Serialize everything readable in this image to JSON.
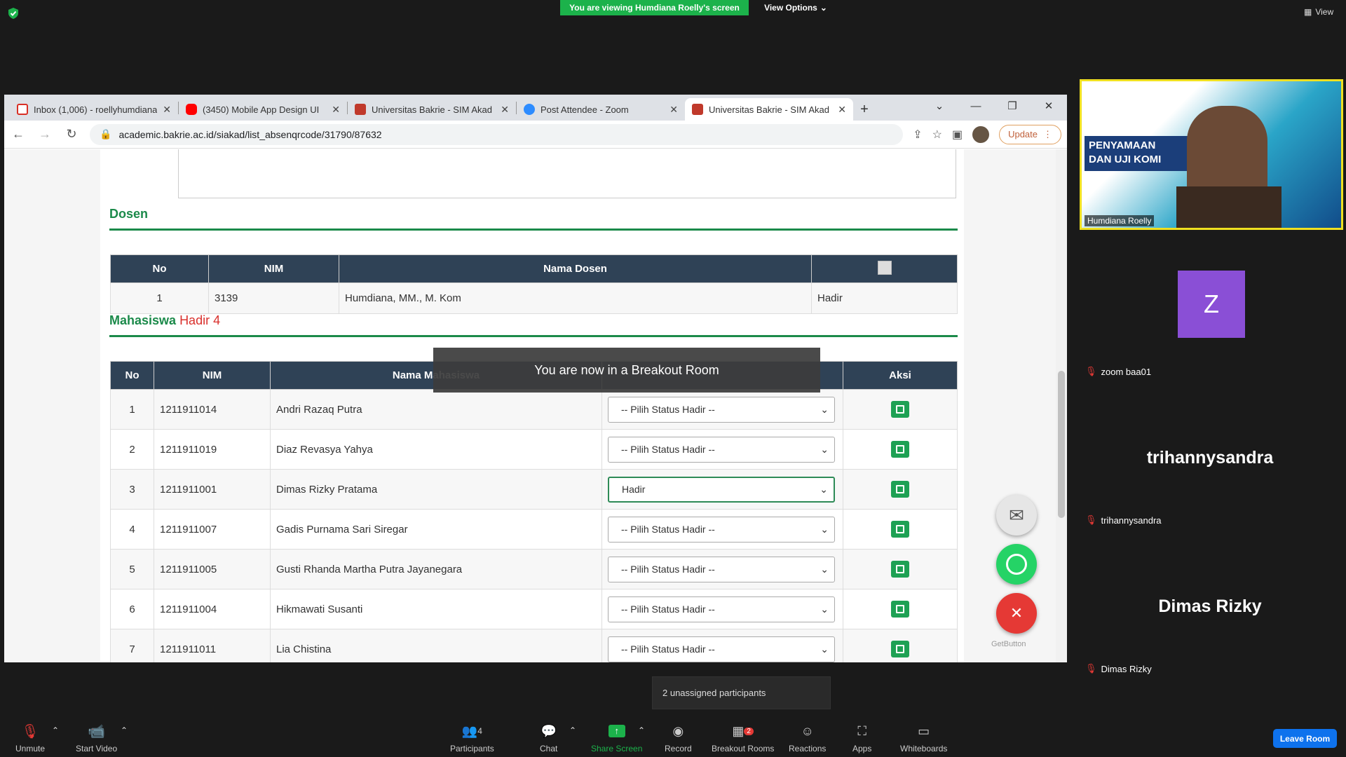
{
  "zoom": {
    "viewing_banner": "You are viewing Humdiana Roelly's screen",
    "view_options": "View Options",
    "view_top": "View",
    "breakout_toast": "You are now in a Breakout Room",
    "unassigned": "2 unassigned participants",
    "toolbar": {
      "unmute": "Unmute",
      "start_video": "Start Video",
      "participants": "Participants",
      "participants_count": "4",
      "chat": "Chat",
      "share_screen": "Share Screen",
      "record": "Record",
      "breakout_rooms": "Breakout Rooms",
      "breakout_badge": "2",
      "reactions": "Reactions",
      "apps": "Apps",
      "whiteboards": "Whiteboards",
      "leave_room": "Leave Room"
    },
    "participants": [
      {
        "name": "Humdiana Roelly",
        "slide_title_1": "PENYAMAAN",
        "slide_title_2": "DAN UJI KOMI"
      },
      {
        "name": "zoom baa01",
        "initial": "Z"
      },
      {
        "name": "trihannysandra",
        "big": "trihannysandra"
      },
      {
        "name": "Dimas Rizky",
        "big": "Dimas Rizky"
      }
    ],
    "getbutton": "GetButton"
  },
  "browser": {
    "tabs": [
      {
        "title": "Inbox (1,006) - roellyhumdiana",
        "icon": "gmail-icon"
      },
      {
        "title": "(3450) Mobile App Design UI",
        "icon": "youtube-icon"
      },
      {
        "title": "Universitas Bakrie - SIM Akad",
        "icon": "bakrie-icon"
      },
      {
        "title": "Post Attendee - Zoom",
        "icon": "zoom-icon"
      },
      {
        "title": "Universitas Bakrie - SIM Akad",
        "icon": "bakrie-icon"
      }
    ],
    "url": "academic.bakrie.ac.id/siakad/list_absenqrcode/31790/87632",
    "update": "Update"
  },
  "page": {
    "dosen_title": "Dosen",
    "dosen_headers": [
      "No",
      "NIM",
      "Nama Dosen",
      ""
    ],
    "dosen_rows": [
      {
        "no": "1",
        "nim": "3139",
        "nama": "Humdiana, MM., M. Kom",
        "status": "Hadir"
      }
    ],
    "mhs_title": "Mahasiswa",
    "mhs_hadir_label": "Hadir",
    "mhs_hadir_count": "4",
    "mhs_headers": [
      "No",
      "NIM",
      "Nama Mahasiswa",
      "",
      "Aksi"
    ],
    "mhs_rows": [
      {
        "no": "1",
        "nim": "1211911014",
        "nama": "Andri Razaq Putra",
        "status": "-- Pilih Status Hadir --"
      },
      {
        "no": "2",
        "nim": "1211911019",
        "nama": "Diaz Revasya Yahya",
        "status": "-- Pilih Status Hadir --"
      },
      {
        "no": "3",
        "nim": "1211911001",
        "nama": "Dimas Rizky Pratama",
        "status": "Hadir"
      },
      {
        "no": "4",
        "nim": "1211911007",
        "nama": "Gadis Purnama Sari Siregar",
        "status": "-- Pilih Status Hadir --"
      },
      {
        "no": "5",
        "nim": "1211911005",
        "nama": "Gusti Rhanda Martha Putra Jayanegara",
        "status": "-- Pilih Status Hadir --"
      },
      {
        "no": "6",
        "nim": "1211911004",
        "nama": "Hikmawati Susanti",
        "status": "-- Pilih Status Hadir --"
      },
      {
        "no": "7",
        "nim": "1211911011",
        "nama": "Lia Chistina",
        "status": "-- Pilih Status Hadir --"
      }
    ]
  },
  "colors": {
    "green_accent": "#1b8a4a",
    "header_bg": "#2f4256",
    "hadir_red": "#d9302c",
    "zoom_green": "#1cb24b",
    "zoom_blue": "#0e72ed"
  }
}
